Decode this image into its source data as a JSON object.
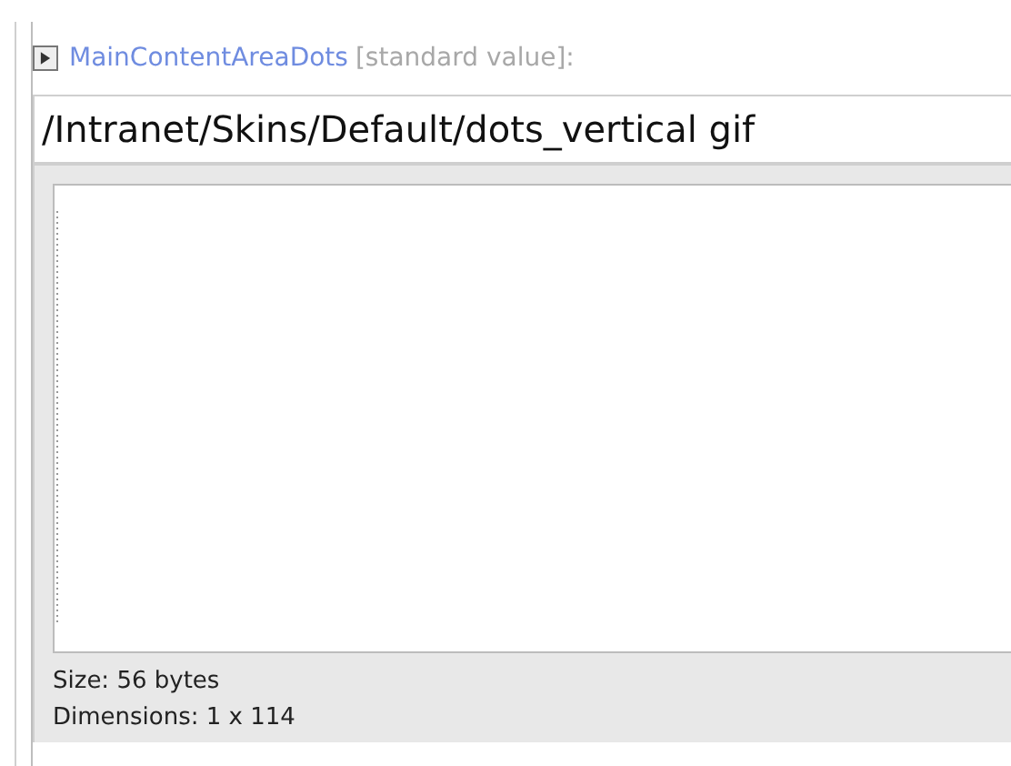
{
  "field": {
    "name": "MainContentAreaDots",
    "note": "[standard value]:",
    "expanded": false,
    "value": "/Intranet/Skins/Default/dots_vertical gif"
  },
  "preview": {
    "size": "Size: 56 bytes",
    "dimensions": "Dimensions: 1 x 114"
  }
}
